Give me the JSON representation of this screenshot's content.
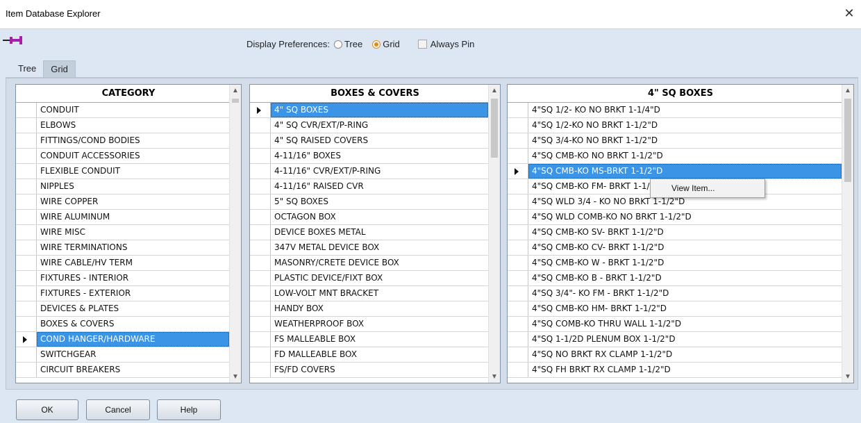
{
  "window": {
    "title": "Item Database Explorer"
  },
  "prefs": {
    "label": "Display Preferences:",
    "tree": "Tree",
    "grid": "Grid",
    "always_pin": "Always Pin",
    "selected": "Grid"
  },
  "tabs": [
    {
      "label": "Tree",
      "active": false
    },
    {
      "label": "Grid",
      "active": true
    }
  ],
  "category": {
    "header": "CATEGORY",
    "selected_index": 15,
    "items": [
      "CONDUIT",
      "ELBOWS",
      "FITTINGS/COND BODIES",
      "CONDUIT ACCESSORIES",
      "FLEXIBLE CONDUIT",
      "NIPPLES",
      "WIRE COPPER",
      "WIRE ALUMINUM",
      "WIRE MISC",
      "WIRE TERMINATIONS",
      "WIRE CABLE/HV TERM",
      "FIXTURES - INTERIOR",
      "FIXTURES - EXTERIOR",
      "DEVICES & PLATES",
      "BOXES & COVERS",
      "COND HANGER/HARDWARE",
      "SWITCHGEAR",
      "CIRCUIT BREAKERS"
    ]
  },
  "subcategory": {
    "header": "BOXES & COVERS",
    "selected_index": 0,
    "items": [
      "4\" SQ BOXES",
      "4\" SQ CVR/EXT/P-RING",
      "4\" SQ RAISED COVERS",
      "4-11/16\" BOXES",
      "4-11/16\" CVR/EXT/P-RING",
      "4-11/16\" RAISED CVR",
      "5\" SQ BOXES",
      "OCTAGON BOX",
      "DEVICE BOXES METAL",
      "347V METAL DEVICE BOX",
      "MASONRY/CRETE DEVICE BOX",
      "PLASTIC DEVICE/FIXT BOX",
      "LOW-VOLT MNT BRACKET",
      "HANDY BOX",
      "WEATHERPROOF BOX",
      "FS MALLEABLE BOX",
      "FD MALLEABLE BOX",
      "FS/FD COVERS"
    ]
  },
  "items": {
    "header": "4\" SQ BOXES",
    "selected_index": 4,
    "items": [
      "4\"SQ  1/2- KO NO BRKT  1-1/4\"D",
      "4\"SQ   1/2-KO NO BRKT  1-1/2\"D",
      "4\"SQ   3/4-KO NO BRKT  1-1/2\"D",
      "4\"SQ  CMB-KO NO BRKT  1-1/2\"D",
      "4\"SQ  CMB-KO  MS-BRKT  1-1/2\"D",
      "4\"SQ  CMB-KO  FM- BRKT  1-1/2\"D",
      "4\"SQ WLD   3/4  -  KO NO BRKT  1-1/2\"D",
      "4\"SQ WLD  COMB-KO NO BRKT  1-1/2\"D",
      "4\"SQ  CMB-KO  SV- BRKT  1-1/2\"D",
      "4\"SQ  CMB-KO  CV- BRKT  1-1/2\"D",
      "4\"SQ  CMB-KO  W - BRKT  1-1/2\"D",
      "4\"SQ  CMB-KO  B  - BRKT  1-1/2\"D",
      "4\"SQ  3/4\"- KO  FM - BRKT  1-1/2\"D",
      "4\"SQ  CMB-KO  HM- BRKT  1-1/2\"D",
      "4\"SQ  COMB-KO THRU WALL  1-1/2\"D",
      "4\"SQ 1-1/2D PLENUM BOX  1-1/2\"D",
      "4\"SQ   NO BRKT RX CLAMP  1-1/2\"D",
      "4\"SQ   FH  BRKT RX CLAMP  1-1/2\"D"
    ]
  },
  "context_menu": {
    "items": [
      "View Item..."
    ]
  },
  "buttons": {
    "ok": "OK",
    "cancel": "Cancel",
    "help": "Help"
  },
  "colors": {
    "selection": "#3b94e6",
    "window_bg": "#dde7f4",
    "radio_checked": "#e38a1a"
  }
}
